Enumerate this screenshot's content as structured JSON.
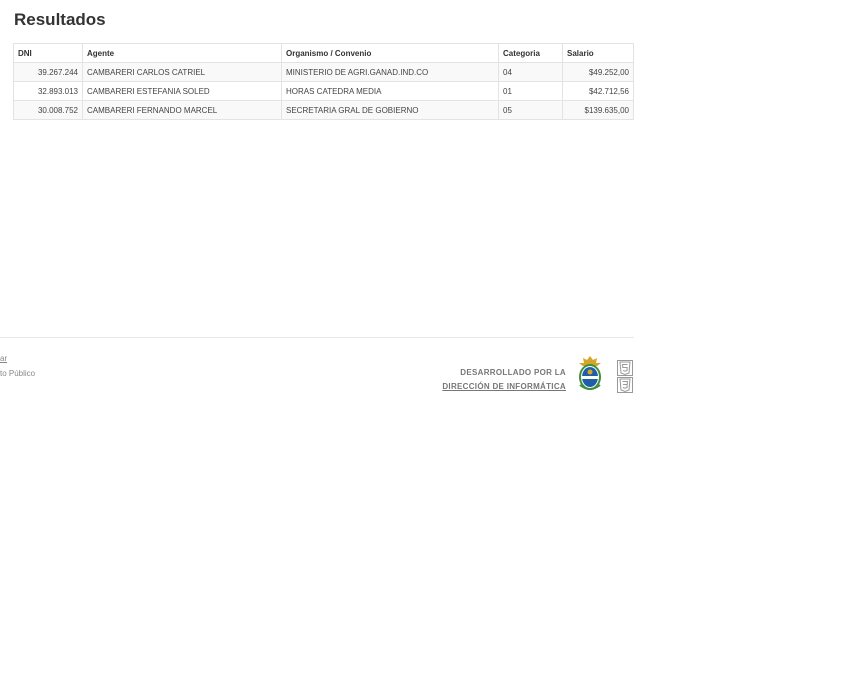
{
  "page": {
    "title": "Resultados"
  },
  "table": {
    "headers": [
      "DNI",
      "Agente",
      "Organismo / Convenio",
      "Categoria",
      "Salario"
    ],
    "rows": [
      [
        "39.267.244",
        "CAMBARERI CARLOS CATRIEL",
        "MINISTERIO DE AGRI.GANAD.IND.CO",
        "04",
        "$49.252,00"
      ],
      [
        "32.893.013",
        "CAMBARERI ESTEFANIA SOLED",
        "HORAS CATEDRA MEDIA",
        "01",
        "$42.712,56"
      ],
      [
        "30.008.752",
        "CAMBARERI FERNANDO MARCEL",
        "SECRETARIA GRAL DE GOBIERNO",
        "05",
        "$139.635,00"
      ]
    ]
  },
  "footer": {
    "left_link": "ar",
    "left_text": "to Público",
    "developed_by": "DESARROLLADO POR LA",
    "developer_link": "DIRECCIÓN DE INFORMÁTICA",
    "icons": [
      "crest-icon",
      "html5-icon",
      "css3-icon"
    ]
  },
  "colors": {
    "border": "#e3e3e3",
    "stripe": "#f9f9f9",
    "text": "#333333",
    "muted": "#888888",
    "crest_blue": "#1f5fa8",
    "crest_gold": "#d4a62a",
    "crest_green": "#3f8f3f"
  }
}
